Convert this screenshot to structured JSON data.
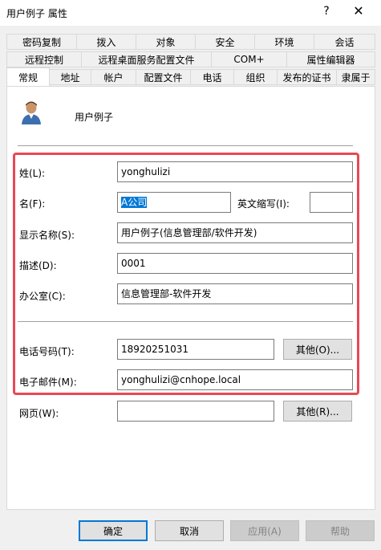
{
  "window": {
    "title": "用户例子 属性",
    "help": "?",
    "close": "✕"
  },
  "tabs": {
    "row1": [
      "密码复制",
      "拨入",
      "对象",
      "安全",
      "环境",
      "会话"
    ],
    "row2": [
      "远程控制",
      "远程桌面服务配置文件",
      "COM+",
      "属性编辑器"
    ],
    "row3": [
      "常规",
      "地址",
      "帐户",
      "配置文件",
      "电话",
      "组织",
      "发布的证书",
      "隶属于"
    ],
    "active": "常规"
  },
  "header": {
    "user_name": "用户例子",
    "icon": "user-icon"
  },
  "form": {
    "surname_label": "姓(L):",
    "surname_value": "yonghulizi",
    "given_label": "名(F):",
    "given_value": "A公司",
    "initials_label": "英文缩写(I):",
    "initials_value": "",
    "display_label": "显示名称(S):",
    "display_value": "用户例子(信息管理部/软件开发)",
    "description_label": "描述(D):",
    "description_value": "0001",
    "office_label": "办公室(C):",
    "office_value": "信息管理部-软件开发",
    "phone_label": "电话号码(T):",
    "phone_value": "18920251031",
    "phone_other": "其他(O)...",
    "email_label": "电子邮件(M):",
    "email_value": "yonghulizi@cnhope.local",
    "web_label": "网页(W):",
    "web_value": "",
    "web_other": "其他(R)..."
  },
  "footer": {
    "ok": "确定",
    "cancel": "取消",
    "apply": "应用(A)",
    "help": "帮助"
  },
  "colors": {
    "highlight": "#e84855",
    "selection": "#0078d7"
  }
}
